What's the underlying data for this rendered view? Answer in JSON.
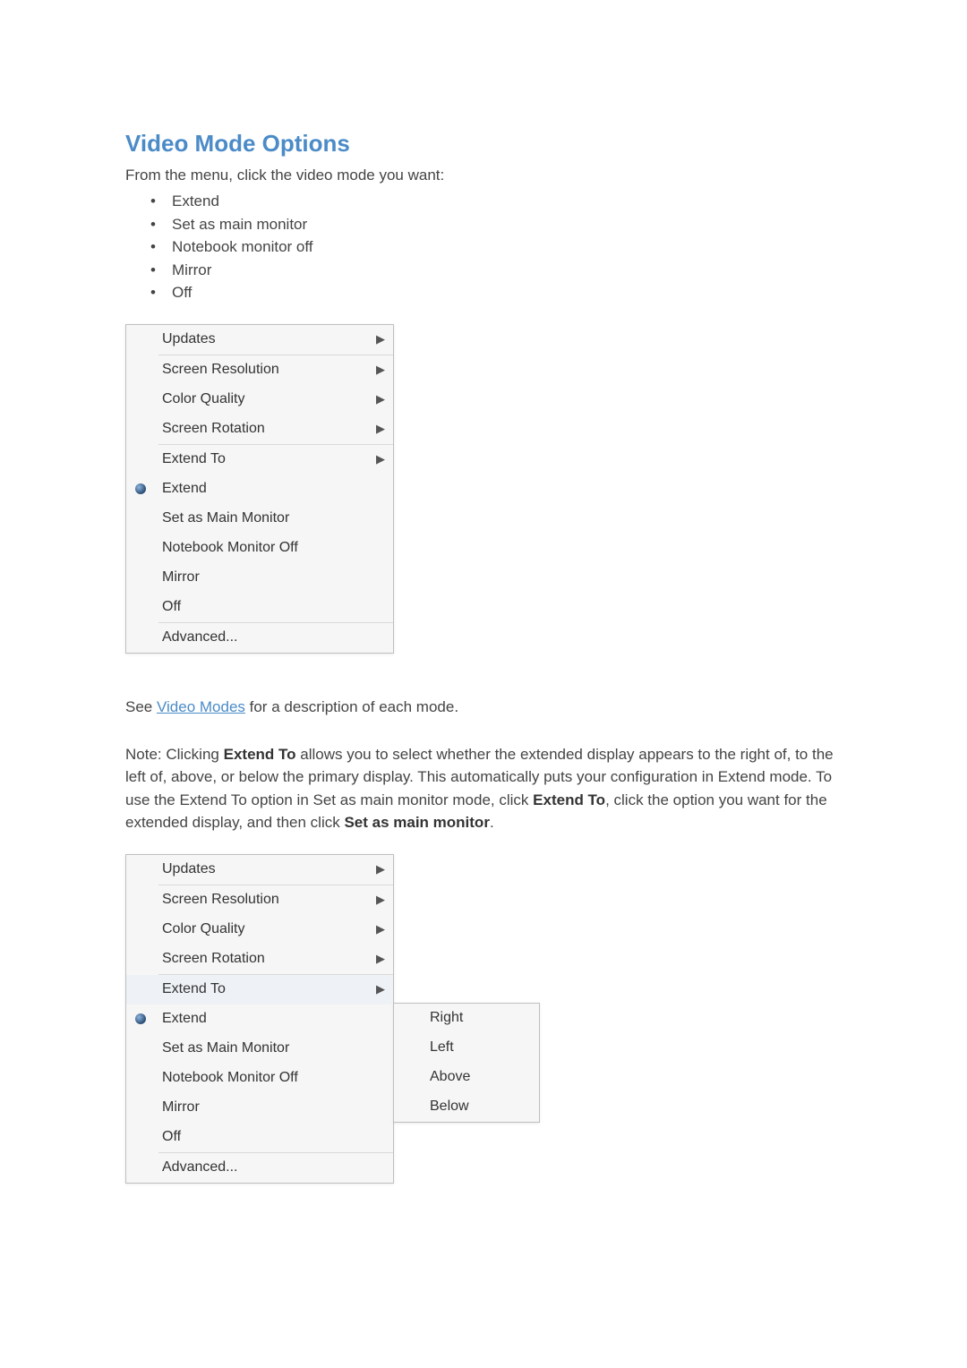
{
  "title": "Video Mode Options",
  "instruction": "From the menu, click the video mode you want:",
  "bullets": [
    "Extend",
    "Set as main monitor",
    "Notebook monitor off",
    "Mirror",
    "Off"
  ],
  "menu": {
    "updates": "Updates",
    "screen_resolution": "Screen Resolution",
    "color_quality": "Color Quality",
    "screen_rotation": "Screen Rotation",
    "extend_to": "Extend To",
    "extend": "Extend",
    "set_as_main": "Set as Main Monitor",
    "notebook_off": "Notebook Monitor Off",
    "mirror": "Mirror",
    "off": "Off",
    "advanced": "Advanced..."
  },
  "see": {
    "pre": "See ",
    "link": "Video Modes",
    "post": " for a description of each mode."
  },
  "note": {
    "t1": "Note: Clicking ",
    "b1": "Extend To",
    "t2": " allows you to select whether the extended display appears to the right of, to the left of, above, or below the primary display. This automatically puts your configuration in Extend mode. To use the Extend To option in Set as main monitor mode, click ",
    "b2": "Extend To",
    "t3": ", click the option you want for the extended display, and then click ",
    "b3": "Set as main monitor",
    "t4": "."
  },
  "submenu": {
    "right": "Right",
    "left": "Left",
    "above": "Above",
    "below": "Below"
  }
}
